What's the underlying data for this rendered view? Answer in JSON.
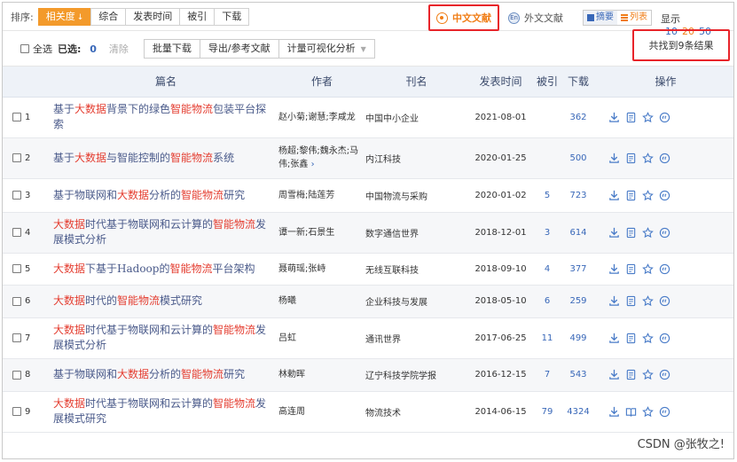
{
  "sortbar": {
    "label": "排序:",
    "options": [
      {
        "label": "相关度",
        "active": true,
        "arrow": "↓"
      },
      {
        "label": "综合",
        "active": false
      },
      {
        "label": "发表时间",
        "active": false
      },
      {
        "label": "被引",
        "active": false
      },
      {
        "label": "下载",
        "active": false
      }
    ],
    "lang_cn": "中文文献",
    "lang_en": "外文文献",
    "lang_en_icon": "En",
    "view_summary": "摘要",
    "view_list": "列表",
    "display_label": "显示",
    "display_sizes": [
      "10",
      "20",
      "50"
    ],
    "display_active": "20"
  },
  "actionbar": {
    "select_all": "全选",
    "selected_label": "已选:",
    "selected_count": "0",
    "clear": "清除",
    "batch_download": "批量下载",
    "export": "导出/参考文献",
    "visual_analysis": "计量可视化分析",
    "result_text": "共找到9条结果"
  },
  "table": {
    "headers": {
      "title": "篇名",
      "author": "作者",
      "journal": "刊名",
      "date": "发表时间",
      "cite": "被引",
      "download": "下载",
      "ops": "操作"
    },
    "rows": [
      {
        "num": "1",
        "title_parts": [
          {
            "t": "基于",
            "hl": false
          },
          {
            "t": "大数据",
            "hl": true
          },
          {
            "t": "背景下的绿色",
            "hl": false
          },
          {
            "t": "智能物流",
            "hl": true
          },
          {
            "t": "包装平台探索",
            "hl": false
          }
        ],
        "author": "赵小菊;谢慧;李咸龙",
        "more": false,
        "journal": "中国中小企业",
        "date": "2021-08-01",
        "cite": "",
        "download": "362"
      },
      {
        "num": "2",
        "title_parts": [
          {
            "t": "基于",
            "hl": false
          },
          {
            "t": "大数据",
            "hl": true
          },
          {
            "t": "与智能控制的",
            "hl": false
          },
          {
            "t": "智能物流",
            "hl": true
          },
          {
            "t": "系统",
            "hl": false
          }
        ],
        "author": "杨超;黎伟;魏永杰;马伟;张鑫",
        "more": true,
        "journal": "内江科技",
        "date": "2020-01-25",
        "cite": "",
        "download": "500"
      },
      {
        "num": "3",
        "title_parts": [
          {
            "t": "基于物联网和",
            "hl": false
          },
          {
            "t": "大数据",
            "hl": true
          },
          {
            "t": "分析的",
            "hl": false
          },
          {
            "t": "智能物流",
            "hl": true
          },
          {
            "t": "研究",
            "hl": false
          }
        ],
        "author": "周雪梅;陆莲芳",
        "more": false,
        "journal": "中国物流与采购",
        "date": "2020-01-02",
        "cite": "5",
        "download": "723"
      },
      {
        "num": "4",
        "title_parts": [
          {
            "t": "大数据",
            "hl": true
          },
          {
            "t": "时代基于物联网和云计算的",
            "hl": false
          },
          {
            "t": "智能物流",
            "hl": true
          },
          {
            "t": "发展模式分析",
            "hl": false
          }
        ],
        "author": "谭一新;石景生",
        "more": false,
        "journal": "数字通信世界",
        "date": "2018-12-01",
        "cite": "3",
        "download": "614"
      },
      {
        "num": "5",
        "title_parts": [
          {
            "t": "大数据",
            "hl": true
          },
          {
            "t": "下基于Hadoop的",
            "hl": false
          },
          {
            "t": "智能物流",
            "hl": true
          },
          {
            "t": "平台架构",
            "hl": false
          }
        ],
        "author": "聂萌瑶;张峙",
        "more": false,
        "journal": "无线互联科技",
        "date": "2018-09-10",
        "cite": "4",
        "download": "377"
      },
      {
        "num": "6",
        "title_parts": [
          {
            "t": "大数据",
            "hl": true
          },
          {
            "t": "时代的",
            "hl": false
          },
          {
            "t": "智能物流",
            "hl": true
          },
          {
            "t": "模式研究",
            "hl": false
          }
        ],
        "author": "杨曦",
        "more": false,
        "journal": "企业科技与发展",
        "date": "2018-05-10",
        "cite": "6",
        "download": "259"
      },
      {
        "num": "7",
        "title_parts": [
          {
            "t": "大数据",
            "hl": true
          },
          {
            "t": "时代基于物联网和云计算的",
            "hl": false
          },
          {
            "t": "智能物流",
            "hl": true
          },
          {
            "t": "发展模式分析",
            "hl": false
          }
        ],
        "author": "吕虹",
        "more": false,
        "journal": "通讯世界",
        "date": "2017-06-25",
        "cite": "11",
        "download": "499"
      },
      {
        "num": "8",
        "title_parts": [
          {
            "t": "基于物联网和",
            "hl": false
          },
          {
            "t": "大数据",
            "hl": true
          },
          {
            "t": "分析的",
            "hl": false
          },
          {
            "t": "智能物流",
            "hl": true
          },
          {
            "t": "研究",
            "hl": false
          }
        ],
        "author": "林勅晖",
        "more": false,
        "journal": "辽宁科技学院学报",
        "date": "2016-12-15",
        "cite": "7",
        "download": "543"
      },
      {
        "num": "9",
        "title_parts": [
          {
            "t": "大数据",
            "hl": true
          },
          {
            "t": "时代基于物联网和云计算的",
            "hl": false
          },
          {
            "t": "智能物流",
            "hl": true
          },
          {
            "t": "发展模式研究",
            "hl": false
          }
        ],
        "author": "高连周",
        "more": false,
        "journal": "物流技术",
        "date": "2014-06-15",
        "cite": "79",
        "download": "4324"
      }
    ]
  },
  "watermark": "CSDN @张牧之!",
  "colors": {
    "accent": "#f39a2b",
    "highlight": "#e43d30",
    "link": "#3867b8",
    "annotation": "#e8242a"
  }
}
